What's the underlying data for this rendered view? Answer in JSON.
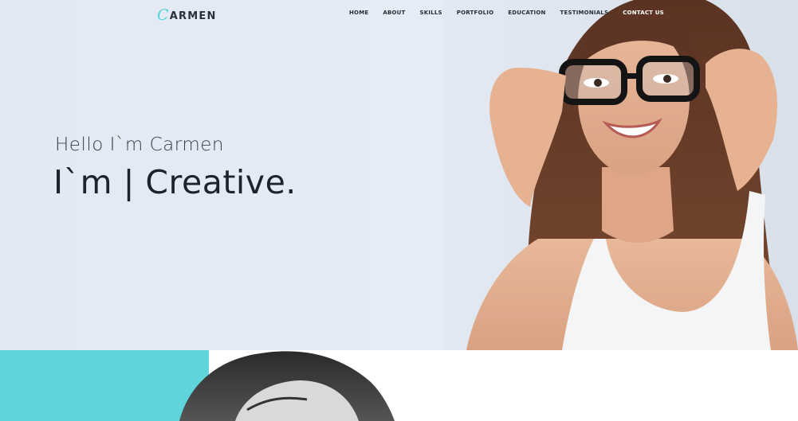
{
  "brand": {
    "mark": "C",
    "rest": "ARMEN"
  },
  "nav": {
    "items": [
      "HOME",
      "ABOUT",
      "SKILLS",
      "PORTFOLIO",
      "EDUCATION",
      "TESTIMONIALS",
      "CONTACT US"
    ]
  },
  "hero": {
    "greeting": "Hello I`m Carmen",
    "headline": "I`m | Creative."
  },
  "colors": {
    "accent": "#5fd5db",
    "hero_background": "#e4eaf4",
    "text_dark": "#1e222b"
  }
}
